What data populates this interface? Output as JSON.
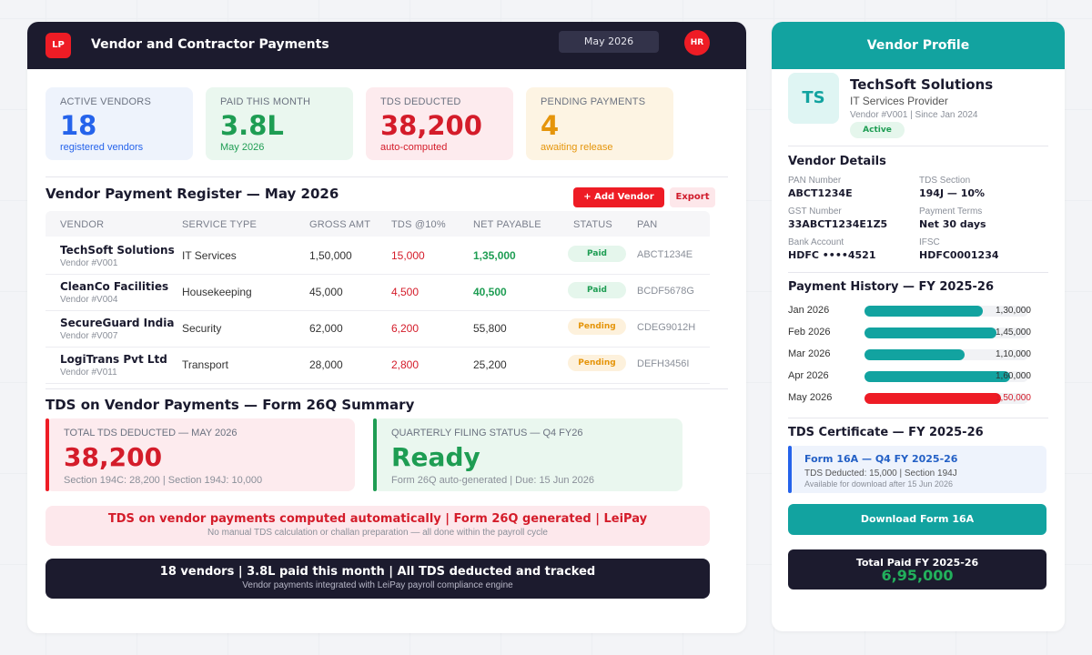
{
  "header": {
    "logo": "LP",
    "title": "Vendor and Contractor Payments",
    "month": "May 2026",
    "avatar": "HR"
  },
  "stats": [
    {
      "label": "ACTIVE VENDORS",
      "value": "18",
      "sub": "registered vendors",
      "color": "#2563eb",
      "bg": "#eef3fc"
    },
    {
      "label": "PAID THIS MONTH",
      "value": "3.8L",
      "sub": "May 2026",
      "color": "#1e9d53",
      "bg": "#eaf7ef"
    },
    {
      "label": "TDS DEDUCTED",
      "value": "38,200",
      "sub": "auto-computed",
      "color": "#d41c2a",
      "bg": "#fdebee"
    },
    {
      "label": "PENDING PAYMENTS",
      "value": "4",
      "sub": "awaiting release",
      "color": "#e5950b",
      "bg": "#fdf4e3"
    }
  ],
  "register": {
    "title": "Vendor Payment Register — May 2026",
    "add_label": "+ Add Vendor",
    "export_label": "Export",
    "columns": [
      "VENDOR",
      "SERVICE TYPE",
      "GROSS AMT",
      "TDS @10%",
      "NET PAYABLE",
      "STATUS",
      "PAN"
    ],
    "rows": [
      {
        "name": "TechSoft Solutions",
        "id": "Vendor #V001",
        "service": "IT Services",
        "gross": "1,50,000",
        "tds": "15,000",
        "net": "1,35,000",
        "status": "Paid",
        "pan": "ABCT1234E"
      },
      {
        "name": "CleanCo Facilities",
        "id": "Vendor #V004",
        "service": "Housekeeping",
        "gross": "45,000",
        "tds": "4,500",
        "net": "40,500",
        "status": "Paid",
        "pan": "BCDF5678G"
      },
      {
        "name": "SecureGuard India",
        "id": "Vendor #V007",
        "service": "Security",
        "gross": "62,000",
        "tds": "6,200",
        "net": "55,800",
        "status": "Pending",
        "pan": "CDEG9012H"
      },
      {
        "name": "LogiTrans Pvt Ltd",
        "id": "Vendor #V011",
        "service": "Transport",
        "gross": "28,000",
        "tds": "2,800",
        "net": "25,200",
        "status": "Pending",
        "pan": "DEFH3456I"
      }
    ]
  },
  "tds_summary": {
    "title": "TDS on Vendor Payments — Form 26Q Summary",
    "left": {
      "label": "TOTAL TDS DEDUCTED — MAY 2026",
      "value": "38,200",
      "sub": "Section 194C: 28,200 | Section 194J: 10,000"
    },
    "right": {
      "label": "QUARTERLY FILING STATUS — Q4 FY26",
      "value": "Ready",
      "sub": "Form 26Q auto-generated | Due: 15 Jun 2026"
    }
  },
  "alert": {
    "main": "TDS on vendor payments computed automatically | Form 26Q generated | LeiPay",
    "sub": "No manual TDS calculation or challan preparation — all done within the payroll cycle"
  },
  "summary": {
    "main": "18 vendors | 3.8L paid this month | All TDS deducted and tracked",
    "sub": "Vendor payments integrated with LeiPay payroll compliance engine"
  },
  "profile": {
    "header": "Vendor Profile",
    "initials": "TS",
    "name": "TechSoft Solutions",
    "type": "IT Services Provider",
    "meta": "Vendor #V001 | Since Jan 2024",
    "badge": "Active",
    "details_title": "Vendor Details",
    "details": [
      {
        "label": "PAN Number",
        "value": "ABCT1234E"
      },
      {
        "label": "TDS Section",
        "value": "194J — 10%"
      },
      {
        "label": "GST Number",
        "value": "33ABCT1234E1Z5"
      },
      {
        "label": "Payment Terms",
        "value": "Net 30 days"
      },
      {
        "label": "Bank Account",
        "value": "HDFC ••••4521"
      },
      {
        "label": "IFSC",
        "value": "HDFC0001234"
      }
    ],
    "history_title": "Payment History — FY 2025-26",
    "history": [
      {
        "month": "Jan 2026",
        "amount": "1,30,000",
        "fraction": 0.722,
        "color": "#12a3a0",
        "amount_color": "#333333"
      },
      {
        "month": "Feb 2026",
        "amount": "1,45,000",
        "fraction": 0.806,
        "color": "#12a3a0",
        "amount_color": "#333333"
      },
      {
        "month": "Mar 2026",
        "amount": "1,10,000",
        "fraction": 0.611,
        "color": "#12a3a0",
        "amount_color": "#333333"
      },
      {
        "month": "Apr 2026",
        "amount": "1,60,000",
        "fraction": 0.889,
        "color": "#12a3a0",
        "amount_color": "#333333"
      },
      {
        "month": "May 2026",
        "amount": "1,50,000",
        "fraction": 0.833,
        "color": "#ee1c25",
        "amount_color": "#d41c2a"
      }
    ],
    "cert_title_section": "TDS Certificate — FY 2025-26",
    "cert": {
      "title": "Form 16A — Q4 FY 2025-26",
      "sub": "TDS Deducted: 15,000 | Section 194J",
      "note": "Available for download after 15 Jun 2026"
    },
    "download_label": "Download Form 16A",
    "total_label": "Total Paid FY 2025-26",
    "total_value": "6,95,000"
  }
}
